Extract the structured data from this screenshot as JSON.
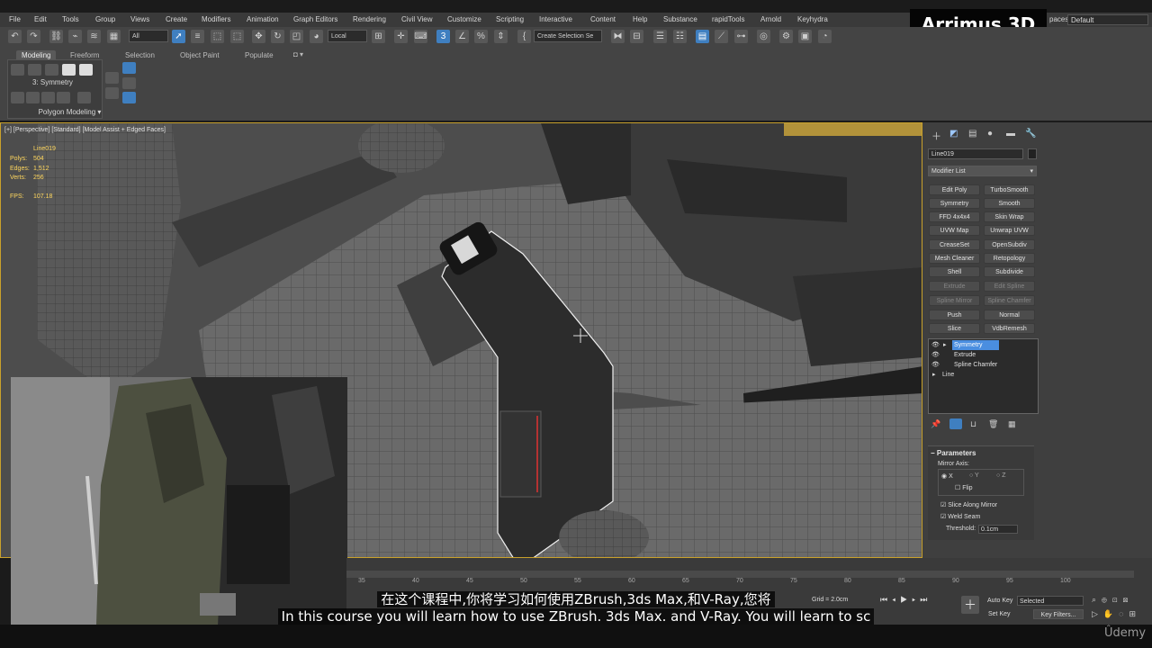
{
  "menu": [
    "File",
    "Edit",
    "Tools",
    "Group",
    "Views",
    "Create",
    "Modifiers",
    "Animation",
    "Graph Editors",
    "Rendering",
    "Civil View",
    "Customize",
    "Scripting",
    "Interactive",
    "Content",
    "Help",
    "Substance",
    "rapidTools",
    "Arnold",
    "Keyhydra"
  ],
  "brand": "Arrimus 3D",
  "workspace": {
    "label": "paces:",
    "value": "Default"
  },
  "toolbar": {
    "selection_filter": "All",
    "coordinate_system": "Local",
    "selection_set_placeholder": "Create Selection Se"
  },
  "ribbon": {
    "tabs": [
      "Modeling",
      "Freeform",
      "Selection",
      "Object Paint",
      "Populate"
    ],
    "active_tab": "Modeling",
    "current_modifier": "3: Symmetry",
    "panel_label": "Polygon Modeling"
  },
  "viewport": {
    "label": "[+] [Perspective] [Standard] [Model Assist + Edged Faces]",
    "object_name": "Line019",
    "stats": [
      {
        "label": "Polys:",
        "value": "504"
      },
      {
        "label": "Edges:",
        "value": "1,512"
      },
      {
        "label": "Verts:",
        "value": "256"
      }
    ],
    "fps_label": "FPS:",
    "fps_value": "107.18"
  },
  "command_panel": {
    "object_name": "Line019",
    "modifier_list_label": "Modifier List",
    "modifier_buttons": [
      {
        "label": "Edit Poly",
        "enabled": true
      },
      {
        "label": "TurboSmooth",
        "enabled": true
      },
      {
        "label": "Symmetry",
        "enabled": true
      },
      {
        "label": "Smooth",
        "enabled": true
      },
      {
        "label": "FFD 4x4x4",
        "enabled": true
      },
      {
        "label": "Skin Wrap",
        "enabled": true
      },
      {
        "label": "UVW Map",
        "enabled": true
      },
      {
        "label": "Unwrap UVW",
        "enabled": true
      },
      {
        "label": "CreaseSet",
        "enabled": true
      },
      {
        "label": "OpenSubdiv",
        "enabled": true
      },
      {
        "label": "Mesh Cleaner",
        "enabled": true
      },
      {
        "label": "Retopology",
        "enabled": true
      },
      {
        "label": "Shell",
        "enabled": true
      },
      {
        "label": "Subdivide",
        "enabled": true
      },
      {
        "label": "Extrude",
        "enabled": false
      },
      {
        "label": "Edit Spline",
        "enabled": false
      },
      {
        "label": "Spline Mirror",
        "enabled": false
      },
      {
        "label": "Spline Chamfer",
        "enabled": false
      },
      {
        "label": "Push",
        "enabled": true
      },
      {
        "label": "Normal",
        "enabled": true
      },
      {
        "label": "Slice",
        "enabled": true
      },
      {
        "label": "VdbRemesh",
        "enabled": true
      }
    ],
    "stack": [
      "Symmetry",
      "Extrude",
      "Spline Chamfer",
      "Line"
    ],
    "stack_selected": "Symmetry",
    "parameters": {
      "title": "Parameters",
      "mirror_axis_label": "Mirror Axis:",
      "axes": [
        "X",
        "Y",
        "Z"
      ],
      "selected_axis": "X",
      "flip_label": "Flip",
      "slice_label": "Slice Along Mirror",
      "weld_label": "Weld Seam",
      "threshold_label": "Threshold:",
      "threshold_value": "0.1cm"
    }
  },
  "timeline": {
    "ticks": [
      "35",
      "40",
      "45",
      "50",
      "55",
      "60",
      "65",
      "70",
      "75",
      "80",
      "85",
      "90",
      "95",
      "100"
    ],
    "grid": "Grid = 2.0cm",
    "auto_key": "Auto Key",
    "set_key": "Set Key",
    "selected": "Selected",
    "key_filters": "Key Filters..."
  },
  "subtitles": {
    "chinese": "在这个课程中,你将学习如何使用ZBrush,3ds Max,和V-Ray,您将",
    "english": "In this course you will learn how to use ZBrush. 3ds Max. and V-Ray. You will learn to sc"
  },
  "watermark": "Ûdemy"
}
